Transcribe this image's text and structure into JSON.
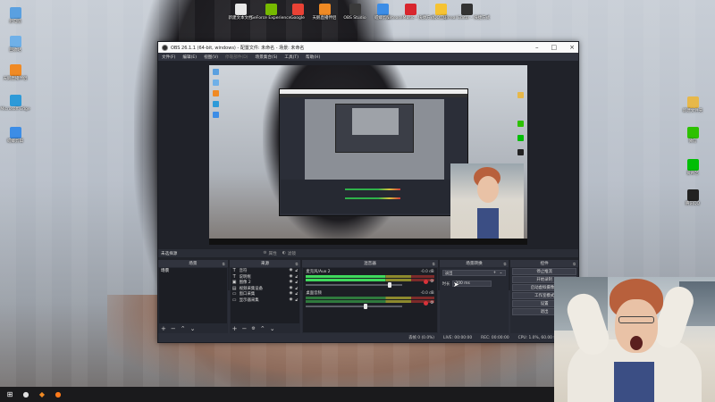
{
  "desktop": {
    "top_icons": [
      {
        "label": "新建文本文档",
        "icon": "document-icon",
        "color": "#e8e8e8"
      },
      {
        "label": "GeForce Experience",
        "icon": "geforce-icon",
        "color": "#76b900"
      },
      {
        "label": "Google",
        "icon": "chrome-icon",
        "color": "#e94235"
      },
      {
        "label": "天鹅直播伴侣",
        "icon": "swan-live-icon",
        "color": "#f08a24"
      },
      {
        "label": "OBS Studio",
        "icon": "obs-icon",
        "color": "#3a3a3a"
      },
      {
        "label": "螳螂剪辑",
        "icon": "mantis-edit-icon",
        "color": "#3c8de6"
      },
      {
        "label": "NeteaseMusic - 快捷方式",
        "icon": "netease-music-icon",
        "color": "#d8262e"
      },
      {
        "label": "QQ音乐",
        "icon": "qq-music-icon",
        "color": "#f6c333"
      },
      {
        "label": "Unreal Editor - 快捷方式",
        "icon": "unreal-icon",
        "color": "#333333"
      }
    ],
    "left_icons": [
      {
        "label": "此电脑",
        "icon": "computer-icon",
        "color": "#5aa0e0"
      },
      {
        "label": "回收站",
        "icon": "recycle-bin-icon",
        "color": "#6fb0e8"
      },
      {
        "label": "天鹅直播伴侣",
        "icon": "swan-live-icon",
        "color": "#f08a24"
      },
      {
        "label": "Microsoft Edge",
        "icon": "edge-icon",
        "color": "#2d9ad8"
      },
      {
        "label": "螳螂剪辑",
        "icon": "mantis-edit-icon",
        "color": "#3c8de6"
      }
    ],
    "right_icons": [
      {
        "label": "新建文件夹",
        "icon": "folder-icon",
        "color": "#e7b84a"
      },
      {
        "label": "微信",
        "icon": "wechat-icon",
        "color": "#2dc100"
      },
      {
        "label": "爱奇艺",
        "icon": "iqiyi-icon",
        "color": "#00be06"
      },
      {
        "label": "腾讯QQ",
        "icon": "qq-icon",
        "color": "#222222"
      }
    ]
  },
  "obs": {
    "title": "OBS 26.1.1 (64-bit, windows) - 配置文件: 未命名 - 场景: 未命名",
    "menu": [
      "文件(F)",
      "编辑(E)",
      "视图(V)",
      "停靠部件(D)",
      "场景集合(S)",
      "工具(T)",
      "帮助(H)"
    ],
    "source_toolbar": {
      "status": "未选择源",
      "props_label": "属性",
      "filters_label": "滤镜"
    },
    "docks": {
      "scenes": {
        "title": "场景",
        "items": [
          "场景"
        ]
      },
      "sources": {
        "title": "来源",
        "items": [
          {
            "icon": "text-source-icon",
            "glyph": "T",
            "label": "音符"
          },
          {
            "icon": "text-source-icon",
            "glyph": "T",
            "label": "说明框"
          },
          {
            "icon": "image-source-icon",
            "glyph": "▣",
            "label": "图像 2"
          },
          {
            "icon": "camera-source-icon",
            "glyph": "▤",
            "label": "视频采集设备"
          },
          {
            "icon": "window-source-icon",
            "glyph": "▭",
            "label": "窗口采集"
          },
          {
            "icon": "display-source-icon",
            "glyph": "▭",
            "label": "显示器采集"
          }
        ]
      },
      "mixer": {
        "title": "混音器",
        "channels": [
          {
            "name": "麦克风/Aux 2",
            "db": "-0.0 dB",
            "level": 0.62,
            "volume": 0.85
          },
          {
            "name": "桌面音频",
            "db": "-0.0 dB",
            "level": 0.0,
            "volume": 0.6
          }
        ]
      },
      "transitions": {
        "title": "场景转换",
        "selected": "淡出",
        "duration_label": "时长",
        "duration_value": "300 ms"
      },
      "controls": {
        "title": "控件",
        "buttons": [
          "停止推流",
          "开始录制",
          "启动虚拟摄像机",
          "工作室模式",
          "设置",
          "退出"
        ]
      }
    },
    "status": {
      "dropped": "丢帧 0 (0.0%)",
      "live": "LIVE: 00:00:00",
      "rec": "REC: 00:00:00",
      "cpu": "CPU: 1.0%, 60.00 fps"
    }
  },
  "taskbar": {
    "items": [
      {
        "icon": "windows-start-icon",
        "glyph": "⊞",
        "color": "#ffffff"
      },
      {
        "icon": "obs-icon",
        "glyph": "●",
        "color": "#e0e0e0"
      },
      {
        "icon": "swan-live-icon",
        "glyph": "◆",
        "color": "#f08a24"
      },
      {
        "icon": "firefox-icon",
        "glyph": "●",
        "color": "#ff7a1a"
      }
    ]
  }
}
